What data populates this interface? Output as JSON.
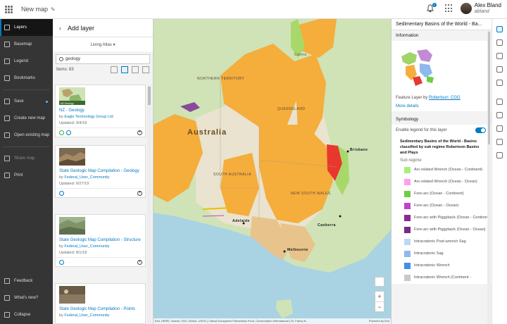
{
  "header": {
    "title": "New map",
    "notification_count": "2",
    "user_name": "Alex Bland",
    "user_handle": "abland"
  },
  "leftnav": {
    "items": [
      {
        "label": "Layers",
        "icon": "layers-icon"
      },
      {
        "label": "Basemap",
        "icon": "basemap-icon"
      },
      {
        "label": "Legend",
        "icon": "legend-icon"
      },
      {
        "label": "Bookmarks",
        "icon": "bookmarks-icon"
      },
      {
        "label": "Save",
        "icon": "save-icon"
      },
      {
        "label": "Create new map",
        "icon": "create-map-icon"
      },
      {
        "label": "Open existing map",
        "icon": "open-map-icon"
      },
      {
        "label": "Share map",
        "icon": "share-icon"
      },
      {
        "label": "Print",
        "icon": "print-icon"
      },
      {
        "label": "Feedback",
        "icon": "feedback-icon"
      },
      {
        "label": "What's new?",
        "icon": "whats-new-icon"
      },
      {
        "label": "Collapse",
        "icon": "collapse-icon"
      }
    ]
  },
  "add_layer": {
    "title": "Add layer",
    "source": "Living Atlas ▾",
    "search_value": "geology",
    "items_count": "Items: 83",
    "cards": [
      {
        "title": "NZ - Geology",
        "by_prefix": "by ",
        "owner": "Eagle Technology Group Ltd",
        "updated": "Updated: 9/4/18",
        "thumb_label": "NZ Geology"
      },
      {
        "title": "State Geologic Map Compilation - Geology",
        "by_prefix": "by ",
        "owner": "Federal_User_Community",
        "updated": "Updated: 6/27/19"
      },
      {
        "title": "State Geologic Map Compilation - Structure",
        "by_prefix": "by ",
        "owner": "Federal_User_Community",
        "updated": "Updated: 8/1/18"
      },
      {
        "title": "State Geologic Map Compilation - Points",
        "by_prefix": "by ",
        "owner": "Federal_User_Community",
        "updated": ""
      }
    ]
  },
  "map": {
    "labels": {
      "country": "Australia",
      "northern_territory": "NORTHERN TERRITORY",
      "queensland": "QUEENSLAND",
      "south_australia": "SOUTH AUSTRALIA",
      "nsw": "NEW SOUTH WALES",
      "adelaide": "Adelaide",
      "melbourne": "Melbourne",
      "brisbane": "Brisbane",
      "canberra": "Canberra",
      "cairns": "Cairns"
    },
    "zoom_in": "+",
    "zoom_out": "−",
    "attribution": "Esri, HERE, Garmin, FAO, NOAA, USGS | Critical Ecosystem Partnership Fund, Conservation International | Dr. Fanny B...",
    "powered": "Powered by Esri"
  },
  "properties": {
    "title": "Sedimentary Basins of the World - Ba...",
    "information_heading": "Information",
    "feature_prefix": "Feature Layer by ",
    "feature_owner": "Robertson_CGG",
    "more_details": "More details",
    "symbology_heading": "Symbology",
    "enable_legend": "Enable legend for this layer",
    "legend_title": "Sedimentary Basins of the World - Basins classified by sub regime Robertson Basins and Plays",
    "legend_sub": "Sub regime",
    "legend_items": [
      {
        "label": "Arc-related Wrench (Ocean - Continent)",
        "color": "#a8ef7a"
      },
      {
        "label": "Arc-related Wrench (Ocean - Ocean)",
        "color": "#ff9ef0"
      },
      {
        "label": "Fore-arc (Ocean - Continent)",
        "color": "#6ccf46"
      },
      {
        "label": "Fore-arc (Ocean - Ocean)",
        "color": "#c244c6"
      },
      {
        "label": "Fore-arc with Piggyback (Ocean - Continent)",
        "color": "#8a2a8e"
      },
      {
        "label": "Fore-arc with Piggyback (Ocean - Ocean)",
        "color": "#7a2a82"
      },
      {
        "label": "Intracratonic Post-wrench Sag",
        "color": "#bfd7f2"
      },
      {
        "label": "Intracratonic Sag",
        "color": "#8fb8ee"
      },
      {
        "label": "Intracratonic Wrench",
        "color": "#3f8fe8"
      },
      {
        "label": "Intracratonic Wrench (Continent -",
        "color": "#c9c9c9"
      }
    ]
  },
  "colors": {
    "accent": "#007ac2",
    "nav_bg": "#353535",
    "basin_orange": "#f5ad3c",
    "basin_tan": "#e8c48c",
    "basin_red": "#e8382e",
    "land_green": "#cfe3b6",
    "ocean": "#a9d3e3"
  }
}
